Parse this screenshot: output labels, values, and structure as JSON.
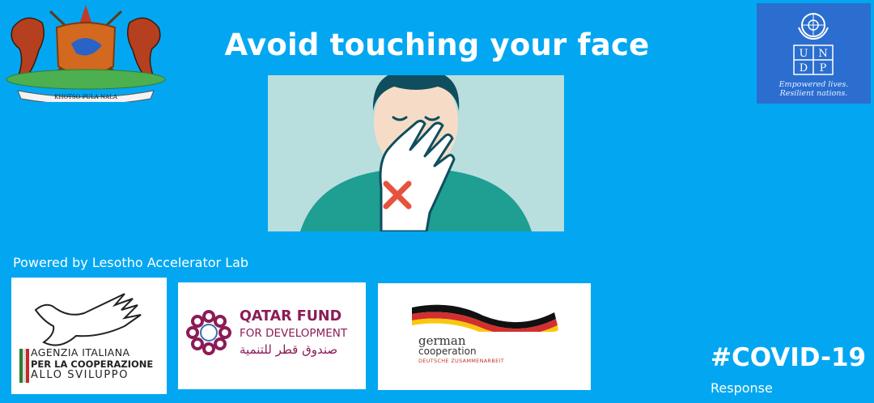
{
  "header": {
    "title": "Avoid touching your face"
  },
  "coat_of_arms": {
    "motto": "KHOTSO PULA NALA"
  },
  "undp": {
    "letters": [
      "U",
      "N",
      "D",
      "P"
    ],
    "tagline_line1": "Empowered lives.",
    "tagline_line2": "Resilient nations.",
    "color": "#2b6ed0"
  },
  "powered_by": "Powered by Lesotho Accelerator Lab",
  "partners": {
    "aics": {
      "line1": "AGENZIA ITALIANA",
      "line2": "PER LA COOPERAZIONE",
      "line3": "ALLO SVILUPPO"
    },
    "qfd": {
      "line1": "QATAR FUND",
      "line2": "FOR DEVELOPMENT",
      "line3": "صندوق قطر للتنمية",
      "color": "#8c1c55"
    },
    "giz": {
      "line1": "german",
      "line2": "cooperation",
      "line3": "DEUTSCHE ZUSAMMENARBEIT"
    }
  },
  "footer": {
    "hashtag": "#COVID-19",
    "subtitle": "Response"
  },
  "colors": {
    "background": "#03a7f1",
    "illustration_bg": "#b9dede",
    "cross": "#e5533d"
  }
}
